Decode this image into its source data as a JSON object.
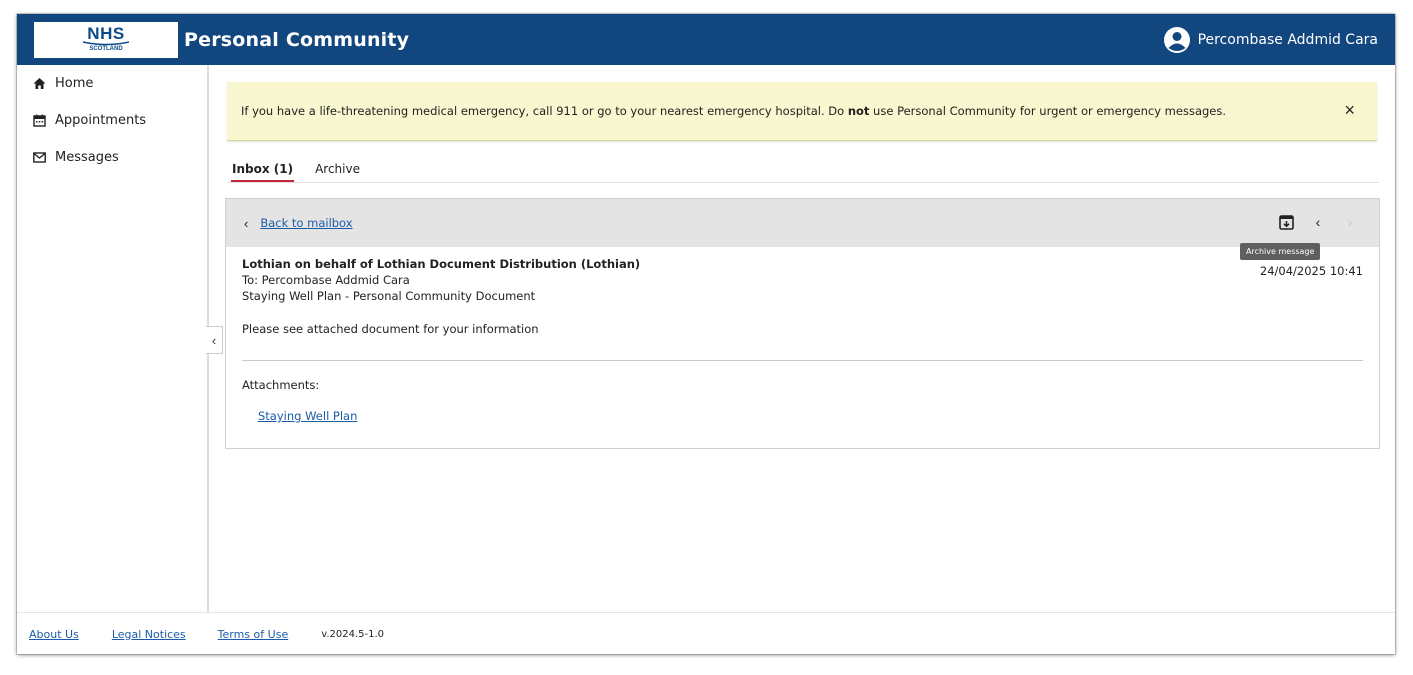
{
  "header": {
    "logo_nhs": "NHS",
    "logo_sub": "SCOTLAND",
    "app_title": "Personal Community",
    "user_name": "Percombase Addmid Cara"
  },
  "sidebar": {
    "items": [
      {
        "label": "Home",
        "icon": "home-icon"
      },
      {
        "label": "Appointments",
        "icon": "calendar-icon"
      },
      {
        "label": "Messages",
        "icon": "mail-icon"
      }
    ]
  },
  "alert": {
    "text_before": "If you have a life-threatening medical emergency, call 911 or go to your nearest emergency hospital. Do ",
    "text_bold": "not",
    "text_after": " use Personal Community for urgent or emergency messages.",
    "close_symbol": "×"
  },
  "tabs": [
    {
      "label": "Inbox (1)",
      "active": true
    },
    {
      "label": "Archive",
      "active": false
    }
  ],
  "toolbar": {
    "back_label": "Back to mailbox",
    "archive_tooltip": "Archive message"
  },
  "message": {
    "from": "Lothian on behalf of Lothian Document Distribution (Lothian)",
    "to": "To: Percombase Addmid Cara",
    "subject": "Staying Well Plan - Personal Community Document",
    "date": "24/04/2025 10:41",
    "body": "Please see attached document for your information",
    "attachments_label": "Attachments:",
    "attachments": [
      "Staying Well Plan"
    ]
  },
  "footer": {
    "about": "About Us",
    "legal": "Legal Notices",
    "terms": "Terms of Use",
    "version": "v.2024.5-1.0"
  },
  "colors": {
    "header_bg": "#12467f",
    "alert_bg": "#f8f7cf",
    "tab_active_underline": "#c4263c",
    "link": "#1a5ca8"
  }
}
